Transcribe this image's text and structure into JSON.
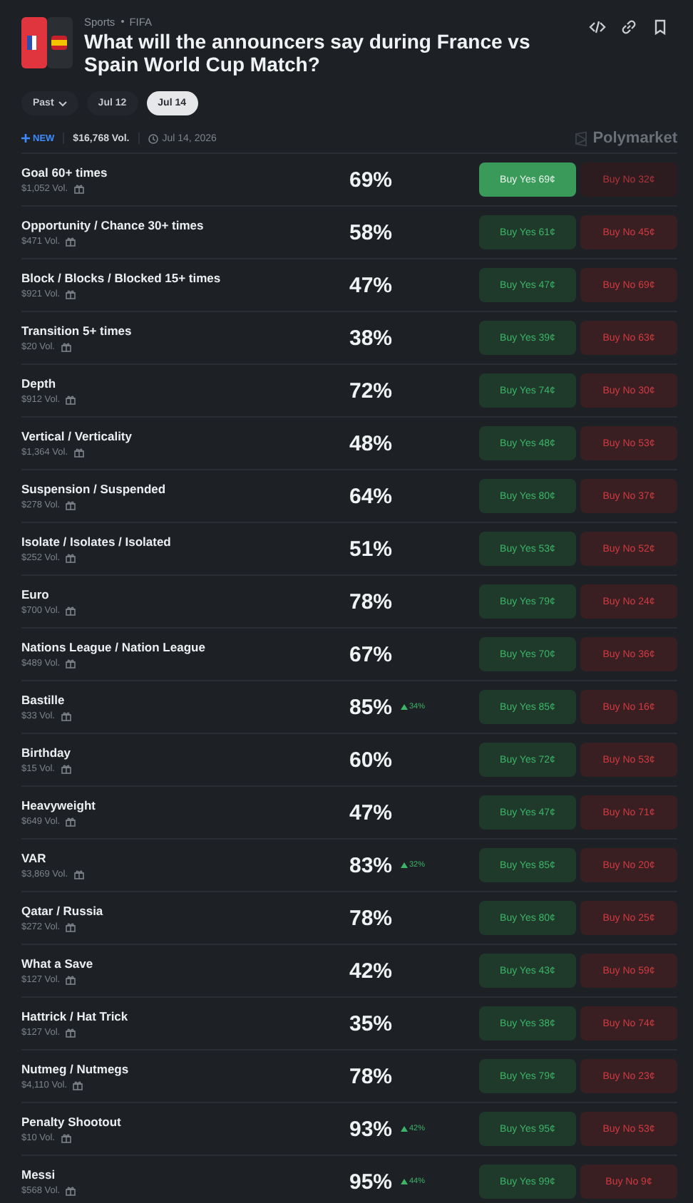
{
  "header": {
    "category": "Sports",
    "subcategory": "FIFA",
    "title": "What will the announcers say during France vs Spain World Cup Match?"
  },
  "date_tabs": [
    {
      "label": "Past",
      "kind": "dropdown",
      "selected": false
    },
    {
      "label": "Jul 12",
      "kind": "date",
      "selected": false
    },
    {
      "label": "Jul 14",
      "kind": "date",
      "selected": true
    }
  ],
  "meta": {
    "badge": "NEW",
    "volume": "$16,768 Vol.",
    "end_date": "Jul 14, 2026",
    "brand": "Polymarket"
  },
  "markets": [
    {
      "name": "Goal 60+ times",
      "volume": "$1,052 Vol.",
      "chance": "69%",
      "yes": "Buy Yes 69¢",
      "no": "Buy No 32¢",
      "selected": true
    },
    {
      "name": "Opportunity / Chance 30+ times",
      "volume": "$471 Vol.",
      "chance": "58%",
      "yes": "Buy Yes 61¢",
      "no": "Buy No 45¢",
      "selected": false
    },
    {
      "name": "Block / Blocks / Blocked 15+ times",
      "volume": "$921 Vol.",
      "chance": "47%",
      "yes": "Buy Yes 47¢",
      "no": "Buy No 69¢",
      "selected": false
    },
    {
      "name": "Transition 5+ times",
      "volume": "$20 Vol.",
      "chance": "38%",
      "yes": "Buy Yes 39¢",
      "no": "Buy No 63¢",
      "selected": false
    },
    {
      "name": "Depth",
      "volume": "$912 Vol.",
      "chance": "72%",
      "yes": "Buy Yes 74¢",
      "no": "Buy No 30¢",
      "selected": false
    },
    {
      "name": "Vertical / Verticality",
      "volume": "$1,364 Vol.",
      "chance": "48%",
      "yes": "Buy Yes 48¢",
      "no": "Buy No 53¢",
      "selected": false
    },
    {
      "name": "Suspension / Suspended",
      "volume": "$278 Vol.",
      "chance": "64%",
      "yes": "Buy Yes 80¢",
      "no": "Buy No 37¢",
      "selected": false
    },
    {
      "name": "Isolate / Isolates / Isolated",
      "volume": "$252 Vol.",
      "chance": "51%",
      "yes": "Buy Yes 53¢",
      "no": "Buy No 52¢",
      "selected": false
    },
    {
      "name": "Euro",
      "volume": "$700 Vol.",
      "chance": "78%",
      "yes": "Buy Yes 79¢",
      "no": "Buy No 24¢",
      "selected": false
    },
    {
      "name": "Nations League / Nation League",
      "volume": "$489 Vol.",
      "chance": "67%",
      "yes": "Buy Yes 70¢",
      "no": "Buy No 36¢",
      "selected": false
    },
    {
      "name": "Bastille",
      "volume": "$33 Vol.",
      "chance": "85%",
      "change": "34%",
      "yes": "Buy Yes 85¢",
      "no": "Buy No 16¢",
      "selected": false
    },
    {
      "name": "Birthday",
      "volume": "$15 Vol.",
      "chance": "60%",
      "yes": "Buy Yes 72¢",
      "no": "Buy No 53¢",
      "selected": false
    },
    {
      "name": "Heavyweight",
      "volume": "$649 Vol.",
      "chance": "47%",
      "yes": "Buy Yes 47¢",
      "no": "Buy No 71¢",
      "selected": false
    },
    {
      "name": "VAR",
      "volume": "$3,869 Vol.",
      "chance": "83%",
      "change": "32%",
      "yes": "Buy Yes 85¢",
      "no": "Buy No 20¢",
      "selected": false
    },
    {
      "name": "Qatar / Russia",
      "volume": "$272 Vol.",
      "chance": "78%",
      "yes": "Buy Yes 80¢",
      "no": "Buy No 25¢",
      "selected": false
    },
    {
      "name": "What a Save",
      "volume": "$127 Vol.",
      "chance": "42%",
      "yes": "Buy Yes 43¢",
      "no": "Buy No 59¢",
      "selected": false
    },
    {
      "name": "Hattrick / Hat Trick",
      "volume": "$127 Vol.",
      "chance": "35%",
      "yes": "Buy Yes 38¢",
      "no": "Buy No 74¢",
      "selected": false
    },
    {
      "name": "Nutmeg / Nutmegs",
      "volume": "$4,110 Vol.",
      "chance": "78%",
      "yes": "Buy Yes 79¢",
      "no": "Buy No 23¢",
      "selected": false
    },
    {
      "name": "Penalty Shootout",
      "volume": "$10 Vol.",
      "chance": "93%",
      "change": "42%",
      "yes": "Buy Yes 95¢",
      "no": "Buy No 53¢",
      "selected": false
    },
    {
      "name": "Messi",
      "volume": "$568 Vol.",
      "chance": "95%",
      "change": "44%",
      "yes": "Buy Yes 99¢",
      "no": "Buy No 9¢",
      "selected": false
    }
  ]
}
